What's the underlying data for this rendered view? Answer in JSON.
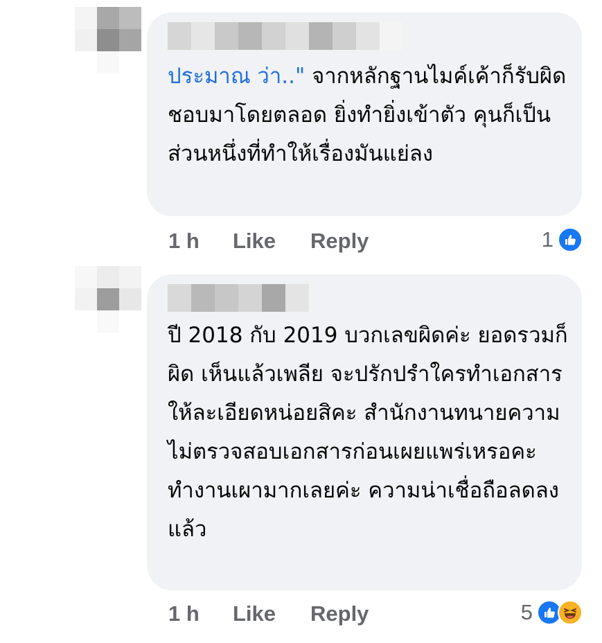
{
  "colors": {
    "bubble_bg": "#f0f2f5",
    "meta_text": "#65676b",
    "link_blue": "#216fdb",
    "like_blue": "#1877f2",
    "haha_yellow": "#f7b125"
  },
  "comments": [
    {
      "quote_text": "ประมาณ ว่า..\"",
      "body_text": " จากหลักฐานไมค์เค้าก็รับผิดชอบมาโดยตลอด ยิ่งทำยิ่งเข้าตัว คุนก็เป็นส่วนหนึ่งที่ทำให้เรื่องมันแย่ลง",
      "time": "1 h",
      "like_label": "Like",
      "reply_label": "Reply",
      "reaction_count": "1",
      "reaction_icons": [
        "like-icon"
      ]
    },
    {
      "quote_text": "",
      "body_text": "ปี 2018 กับ 2019 บวกเลขผิดค่ะ ยอดรวมก็ผิด เห็นแล้วเพลีย จะปรักปรำใครทำเอกสารให้ละเอียดหน่อยสิคะ  สำนักงานทนายความไม่ตรวจสอบเอกสารก่อนเผยแพร่เหรอคะ  ทำงานเผามากเลยค่ะ ความน่าเชื่อถือลดลงแล้ว",
      "time": "1 h",
      "like_label": "Like",
      "reply_label": "Reply",
      "reaction_count": "5",
      "reaction_icons": [
        "like-icon",
        "haha-icon"
      ]
    }
  ]
}
